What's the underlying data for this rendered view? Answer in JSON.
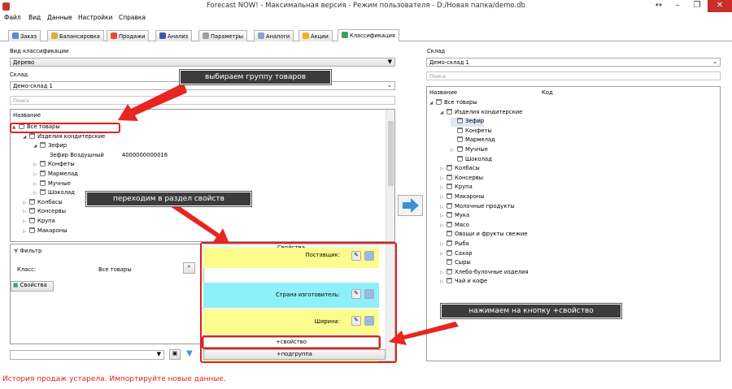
{
  "window": {
    "title": "Forecast NOW! - Максимальная версия - Режим пользователя - D:/Новая папка/demo.db"
  },
  "menu": [
    "Файл",
    "Вид",
    "Данные",
    "Настройки",
    "Справка"
  ],
  "tabs": [
    {
      "label": "Заказ",
      "color": "#5a8ad6"
    },
    {
      "label": "Балансировка",
      "color": "#d8b040"
    },
    {
      "label": "Продажи",
      "color": "#e34c3a"
    },
    {
      "label": "Анализ",
      "color": "#3d5aa8"
    },
    {
      "label": "Параметры",
      "color": "#9aa0a6"
    },
    {
      "label": "Аналоги",
      "color": "#8aa4c8"
    },
    {
      "label": "Акции",
      "color": "#f0b020"
    },
    {
      "label": "Классификация",
      "color": "#3aa06a"
    }
  ],
  "left": {
    "classification_label": "Вид классификации",
    "classification_value": "Дерево",
    "warehouse_label": "Склад",
    "warehouse_value": "Демо-склад 1",
    "search_placeholder": "Поиск",
    "tree_header": "Название",
    "tree": [
      {
        "label": "Все товары",
        "level": 0,
        "toggle": "▲"
      },
      {
        "label": "Изделия кондитерские",
        "level": 1,
        "toggle": "◢"
      },
      {
        "label": "Зефир",
        "level": 2,
        "toggle": "◢"
      },
      {
        "label": "Зефир Воздушный",
        "level": 3,
        "toggle": "",
        "code": "4000000000016"
      },
      {
        "label": "Конфеты",
        "level": 2,
        "toggle": "▷"
      },
      {
        "label": "Мармелад",
        "level": 2,
        "toggle": "▷"
      },
      {
        "label": "Мучные",
        "level": 2,
        "toggle": "▷"
      },
      {
        "label": "Шоколад",
        "level": 2,
        "toggle": "▷"
      },
      {
        "label": "Колбасы",
        "level": 1,
        "toggle": "▷"
      },
      {
        "label": "Консервы",
        "level": 1,
        "toggle": "▷"
      },
      {
        "label": "Крупа",
        "level": 1,
        "toggle": "▷"
      },
      {
        "label": "Макароны",
        "level": 1,
        "toggle": "▷"
      }
    ],
    "filter_title": "Фильтр",
    "class_label": "Класс:",
    "class_value": "Все товары",
    "properties_button": "Свойства"
  },
  "properties": {
    "title": "Свойства",
    "rows": [
      {
        "label": "Поставщик:",
        "color": "#fdfd8e"
      },
      {
        "label": "Страна изготовитель:",
        "color": "#8ef0f8"
      },
      {
        "label": "Ширина:",
        "color": "#fdfd8e"
      },
      {
        "label": "Ширина:",
        "color": "#fdfd8e"
      }
    ],
    "add_property": "+свойство",
    "add_subgroup": "+подгруппа"
  },
  "right": {
    "warehouse_label": "Склад",
    "warehouse_value": "Демо-склад 1",
    "search_placeholder": "Поиск",
    "col_name": "Название",
    "col_code": "Код",
    "tree": [
      {
        "label": "Все товары",
        "level": 0,
        "toggle": "◢"
      },
      {
        "label": "Изделия кондитерские",
        "level": 1,
        "toggle": "◢"
      },
      {
        "label": "Зефир",
        "level": 2,
        "toggle": "",
        "selected": true
      },
      {
        "label": "Конфеты",
        "level": 2,
        "toggle": ""
      },
      {
        "label": "Мармелад",
        "level": 2,
        "toggle": ""
      },
      {
        "label": "Мучные",
        "level": 2,
        "toggle": "▷"
      },
      {
        "label": "Шоколад",
        "level": 2,
        "toggle": ""
      },
      {
        "label": "Колбасы",
        "level": 1,
        "toggle": "▷"
      },
      {
        "label": "Консервы",
        "level": 1,
        "toggle": "▷"
      },
      {
        "label": "Крупа",
        "level": 1,
        "toggle": "▷"
      },
      {
        "label": "Макароны",
        "level": 1,
        "toggle": "▷"
      },
      {
        "label": "Молочные продукты",
        "level": 1,
        "toggle": "▷"
      },
      {
        "label": "Мука",
        "level": 1,
        "toggle": "▷"
      },
      {
        "label": "Мясо",
        "level": 1,
        "toggle": "▷"
      },
      {
        "label": "Овощи и фрукты свежие",
        "level": 1,
        "toggle": ""
      },
      {
        "label": "Рыба",
        "level": 1,
        "toggle": "▷"
      },
      {
        "label": "Сахар",
        "level": 1,
        "toggle": "▷"
      },
      {
        "label": "Сыры",
        "level": 1,
        "toggle": ""
      },
      {
        "label": "Хлебо-булочные изделия",
        "level": 1,
        "toggle": "▷"
      },
      {
        "label": "Чай и кофе",
        "level": 1,
        "toggle": "▷"
      }
    ]
  },
  "annotations": {
    "select_group": "выбираем группу товаров",
    "go_properties": "переходим в раздел свойств",
    "press_add": "нажимаем на кнопку +свойство"
  },
  "status": "История продаж устарела. Импортируйте новые данные.",
  "colors": {
    "accent_red": "#e02020",
    "arrow_blue": "#3b8fd6"
  }
}
